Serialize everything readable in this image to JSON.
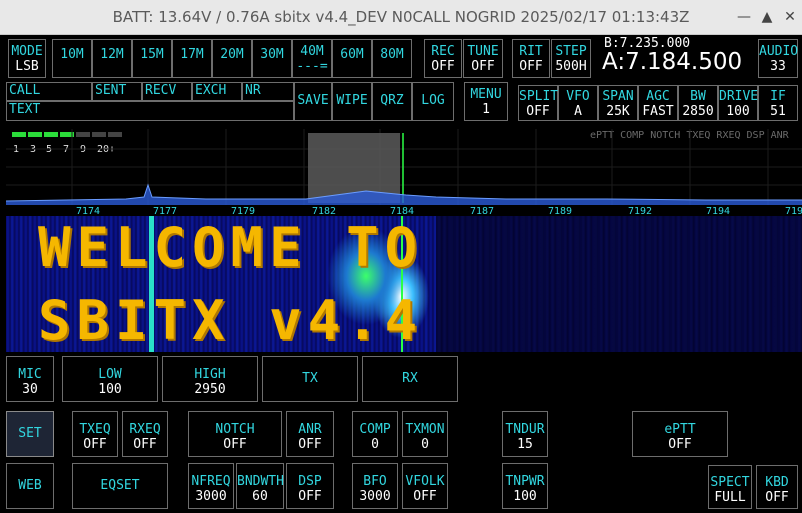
{
  "window": {
    "title": "BATT: 13.64V / 0.76A  sbitx v4.4_DEV  N0CALL  NOGRID  2025/02/17  01:13:43Z"
  },
  "top_row": {
    "mode": {
      "label": "MODE",
      "value": "LSB"
    },
    "bands": [
      "10M",
      "12M",
      "15M",
      "17M",
      "20M",
      "30M",
      "40M",
      "60M",
      "80M"
    ],
    "band_40_extra": "---=",
    "rec": {
      "label": "REC",
      "value": "OFF"
    },
    "tune": {
      "label": "TUNE",
      "value": "OFF"
    },
    "rit": {
      "label": "RIT",
      "value": "OFF"
    },
    "step": {
      "label": "STEP",
      "value": "500H"
    },
    "vfo_b": "B:7.235.000",
    "vfo_a": "A:7.184.500",
    "audio": {
      "label": "AUDIO",
      "value": "33"
    }
  },
  "log_row": {
    "call": "CALL",
    "sent": "SENT",
    "recv": "RECV",
    "exch": "EXCH",
    "nr": "NR",
    "text": "TEXT",
    "save": "SAVE",
    "wipe": "WIPE",
    "qrz": "QRZ",
    "log": "LOG",
    "menu": {
      "label": "MENU",
      "value": "1"
    },
    "split": {
      "label": "SPLIT",
      "value": "OFF"
    },
    "vfo": {
      "label": "VFO",
      "value": "A"
    },
    "span": {
      "label": "SPAN",
      "value": "25K"
    },
    "agc": {
      "label": "AGC",
      "value": "FAST"
    },
    "bw": {
      "label": "BW",
      "value": "2850"
    },
    "drive": {
      "label": "DRIVE",
      "value": "100"
    },
    "if": {
      "label": "IF",
      "value": "51"
    }
  },
  "smeter_labels": [
    "1",
    "3",
    "5",
    "7",
    "9",
    "20+"
  ],
  "status_line": "ePTT  COMP NOTCH  TXEQ  RXEQ DSP ANR",
  "freq_ticks": [
    "7174",
    "7177",
    "7179",
    "7182",
    "7184",
    "7187",
    "7189",
    "7192",
    "7194",
    "719"
  ],
  "welcome": {
    "line1": "WELCOME TO",
    "line2": "SBITX v4.4"
  },
  "controls": {
    "mic": {
      "label": "MIC",
      "value": "30"
    },
    "low": {
      "label": "LOW",
      "value": "100"
    },
    "high": {
      "label": "HIGH",
      "value": "2950"
    },
    "tx": "TX",
    "rx": "RX",
    "set": "SET",
    "web": "WEB",
    "eqset": "EQSET",
    "txeq": {
      "label": "TXEQ",
      "value": "OFF"
    },
    "rxeq": {
      "label": "RXEQ",
      "value": "OFF"
    },
    "notch": {
      "label": "NOTCH",
      "value": "OFF"
    },
    "anr": {
      "label": "ANR",
      "value": "OFF"
    },
    "comp": {
      "label": "COMP",
      "value": "0"
    },
    "txmon": {
      "label": "TXMON",
      "value": "0"
    },
    "tndur": {
      "label": "TNDUR",
      "value": "15"
    },
    "eptt": {
      "label": "ePTT",
      "value": "OFF"
    },
    "nfreq": {
      "label": "NFREQ",
      "value": "3000"
    },
    "bndwth": {
      "label": "BNDWTH",
      "value": "60"
    },
    "dsp": {
      "label": "DSP",
      "value": "OFF"
    },
    "bfo": {
      "label": "BFO",
      "value": "3000"
    },
    "vfolk": {
      "label": "VFOLK",
      "value": "OFF"
    },
    "tnpwr": {
      "label": "TNPWR",
      "value": "100"
    },
    "spect": {
      "label": "SPECT",
      "value": "FULL"
    },
    "kbd": {
      "label": "KBD",
      "value": "OFF"
    }
  },
  "colors": {
    "label": "#32d7e0",
    "value": "#ffffff",
    "welcome": "#f5b700",
    "set_bg": "#1e2535"
  }
}
